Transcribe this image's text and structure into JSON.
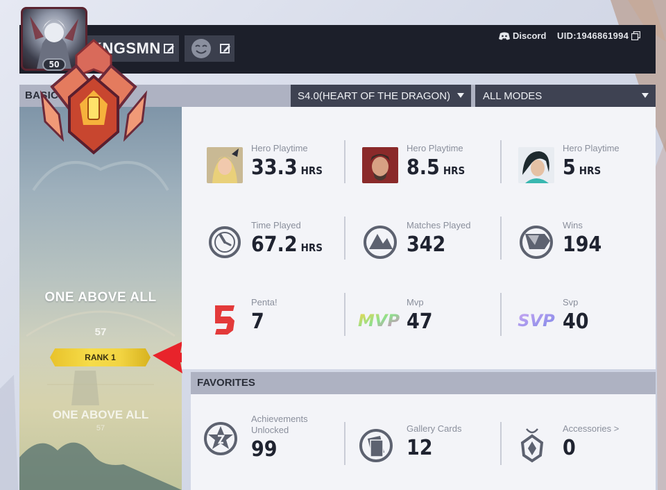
{
  "profile": {
    "name": "KNGSMN",
    "level": "50",
    "discord_label": "Discord",
    "uid": "UID:1946861994"
  },
  "basic_stats": {
    "title": "BASIC STATS",
    "season_dropdown": "S4.0(HEART OF THE DRAGON)",
    "mode_dropdown": "ALL MODES"
  },
  "rank": {
    "name": "ONE ABOVE ALL",
    "points": "57",
    "badge": "RANK 1",
    "secondary_name": "ONE ABOVE ALL",
    "secondary_points": "57"
  },
  "stats": [
    {
      "label": "Hero Playtime",
      "value": "33.3",
      "unit": "HRS",
      "icon": "hero-portrait-1"
    },
    {
      "label": "Hero Playtime",
      "value": "8.5",
      "unit": "HRS",
      "icon": "hero-portrait-2"
    },
    {
      "label": "Hero Playtime",
      "value": "5",
      "unit": "HRS",
      "icon": "hero-portrait-3"
    },
    {
      "label": "Time Played",
      "value": "67.2",
      "unit": "HRS",
      "icon": "clock-icon"
    },
    {
      "label": "Matches Played",
      "value": "342",
      "unit": "",
      "icon": "matches-icon"
    },
    {
      "label": "Wins",
      "value": "194",
      "unit": "",
      "icon": "flag-icon"
    },
    {
      "label": "Penta!",
      "value": "7",
      "unit": "",
      "icon": "penta-icon"
    },
    {
      "label": "Mvp",
      "value": "47",
      "unit": "",
      "icon": "mvp-icon"
    },
    {
      "label": "Svp",
      "value": "40",
      "unit": "",
      "icon": "svp-icon"
    }
  ],
  "favorites": {
    "title": "FAVORITES",
    "items": [
      {
        "label": "Achievements Unlocked",
        "value": "99",
        "icon": "achievement-icon"
      },
      {
        "label": "Gallery Cards",
        "value": "12",
        "icon": "gallery-cards-icon"
      },
      {
        "label": "Accessories >",
        "value": "0",
        "icon": "accessories-icon"
      }
    ]
  },
  "colors": {
    "header_bg": "#1c1f2a",
    "section_bar": "#aeb2c2",
    "dropdown_bg": "#3e4252",
    "card_bg": "#f3f4f8",
    "rank_badge": "#f2d442",
    "annotation_arrow": "#e8232b",
    "penta_red": "#e33a3a"
  }
}
